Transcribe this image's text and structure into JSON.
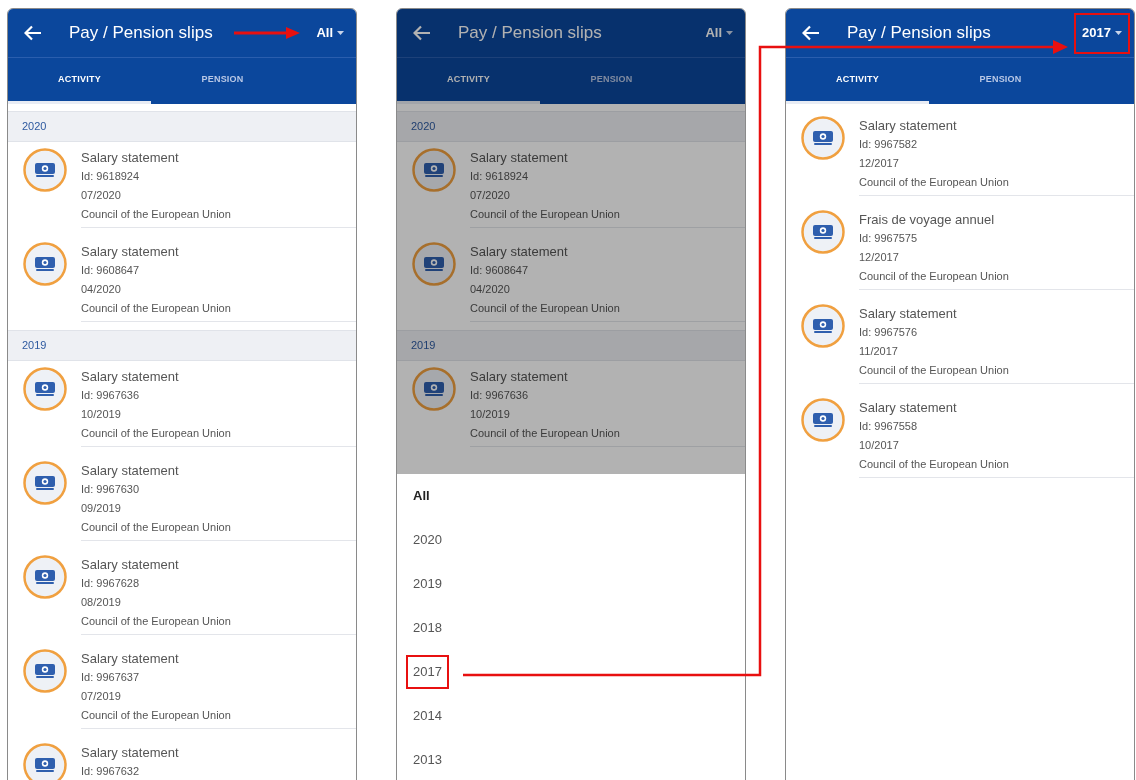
{
  "screens": [
    {
      "title": "Pay / Pension slips",
      "filter": {
        "label": "All",
        "arrow": true,
        "highlighted": false
      },
      "tabs": [
        {
          "label": "ACTIVITY",
          "selected": true
        },
        {
          "label": "PENSION",
          "selected": false
        }
      ],
      "dimmed": false,
      "groups": [
        {
          "year": "2020",
          "items": [
            {
              "title": "Salary statement",
              "id": "Id: 9618924",
              "date": "07/2020",
              "org": "Council of the European Union"
            },
            {
              "title": "Salary statement",
              "id": "Id: 9608647",
              "date": "04/2020",
              "org": "Council of the European Union"
            }
          ]
        },
        {
          "year": "2019",
          "items": [
            {
              "title": "Salary statement",
              "id": "Id: 9967636",
              "date": "10/2019",
              "org": "Council of the European Union"
            },
            {
              "title": "Salary statement",
              "id": "Id: 9967630",
              "date": "09/2019",
              "org": "Council of the European Union"
            },
            {
              "title": "Salary statement",
              "id": "Id: 9967628",
              "date": "08/2019",
              "org": "Council of the European Union"
            },
            {
              "title": "Salary statement",
              "id": "Id: 9967637",
              "date": "07/2019",
              "org": "Council of the European Union"
            },
            {
              "title": "Salary statement",
              "id": "Id: 9967632"
            }
          ]
        }
      ]
    },
    {
      "title": "Pay / Pension slips",
      "filter": {
        "label": "All",
        "arrow": false,
        "highlighted": false
      },
      "tabs": [
        {
          "label": "ACTIVITY",
          "selected": true
        },
        {
          "label": "PENSION",
          "selected": false
        }
      ],
      "dimmed": true,
      "groups": [
        {
          "year": "2020",
          "items": [
            {
              "title": "Salary statement",
              "id": "Id: 9618924",
              "date": "07/2020",
              "org": "Council of the European Union"
            },
            {
              "title": "Salary statement",
              "id": "Id: 9608647",
              "date": "04/2020",
              "org": "Council of the European Union"
            }
          ]
        },
        {
          "year": "2019",
          "items": [
            {
              "title": "Salary statement",
              "id": "Id: 9967636",
              "date": "10/2019",
              "org": "Council of the European Union"
            }
          ]
        }
      ],
      "menu": [
        {
          "label": "All",
          "selected": true,
          "highlighted": false
        },
        {
          "label": "2020",
          "selected": false,
          "highlighted": false
        },
        {
          "label": "2019",
          "selected": false,
          "highlighted": false
        },
        {
          "label": "2018",
          "selected": false,
          "highlighted": false
        },
        {
          "label": "2017",
          "selected": false,
          "highlighted": true
        },
        {
          "label": "2014",
          "selected": false,
          "highlighted": false
        },
        {
          "label": "2013",
          "selected": false,
          "highlighted": false
        }
      ]
    },
    {
      "title": "Pay / Pension slips",
      "filter": {
        "label": "2017",
        "arrow": false,
        "highlighted": true
      },
      "tabs": [
        {
          "label": "ACTIVITY",
          "selected": true
        },
        {
          "label": "PENSION",
          "selected": false
        }
      ],
      "dimmed": false,
      "groups": [
        {
          "items": [
            {
              "title": "Salary statement",
              "id": "Id: 9967582",
              "date": "12/2017",
              "org": "Council of the European Union"
            },
            {
              "title": "Frais de voyage annuel",
              "id": "Id: 9967575",
              "date": "12/2017",
              "org": "Council of the European Union"
            },
            {
              "title": "Salary statement",
              "id": "Id: 9967576",
              "date": "11/2017",
              "org": "Council of the European Union"
            },
            {
              "title": "Salary statement",
              "id": "Id: 9967558",
              "date": "10/2017",
              "org": "Council of the European Union"
            }
          ]
        }
      ]
    }
  ]
}
